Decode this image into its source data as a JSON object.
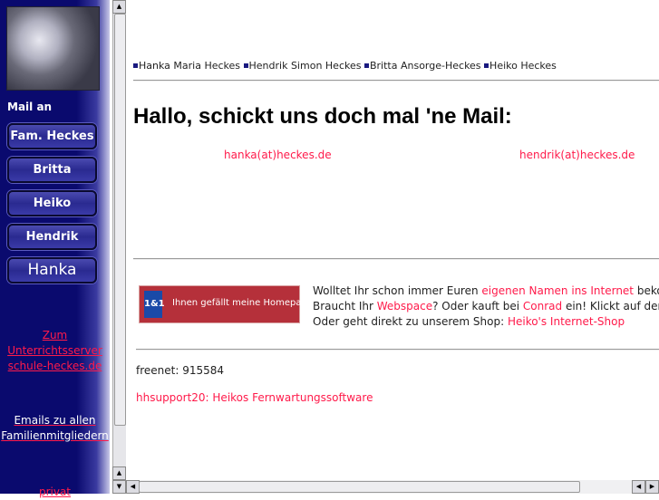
{
  "sidebar": {
    "mail_label": "Mail an",
    "buttons": [
      "Fam. Heckes",
      "Britta",
      "Heiko",
      "Hendrik",
      "Hanka"
    ],
    "link_server": [
      "Zum",
      "Unterrichtsserver",
      "schule-heckes.de"
    ],
    "link_emails": [
      "Emails zu allen",
      "Familienmitgliedern"
    ],
    "link_privat": "privat"
  },
  "main": {
    "names": [
      "Hanka Maria Heckes",
      "Hendrik Simon Heckes",
      "Britta Ansorge-Heckes",
      "Heiko Heckes"
    ],
    "heading": "Hallo, schickt uns doch mal 'ne Mail:",
    "emails": [
      "hanka(at)heckes.de",
      "hendrik(at)heckes.de"
    ],
    "banner": {
      "logo": "1&1",
      "text": "Ihnen gefällt meine Homepage?"
    },
    "promo": {
      "l1_pre": "Wolltet Ihr schon immer Euren ",
      "l1_link": "eigenen Namen ins Internet",
      "l1_post": " bekommen?",
      "l2_pre": "Braucht Ihr ",
      "l2_link1": "Webspace",
      "l2_mid": "? Oder kauft bei ",
      "l2_link2": "Conrad",
      "l2_post": " ein! Klickt auf den Banner!",
      "l3_pre": "Oder geht direkt zu unserem Shop: ",
      "l3_link": "Heiko's Internet-Shop"
    },
    "freenet": "freenet: 915584",
    "hhsupport": "hhsupport20: Heikos Fernwartungssoftware"
  },
  "colors": {
    "sidebar": "#0a0a6e",
    "link": "#ff1a4a"
  }
}
